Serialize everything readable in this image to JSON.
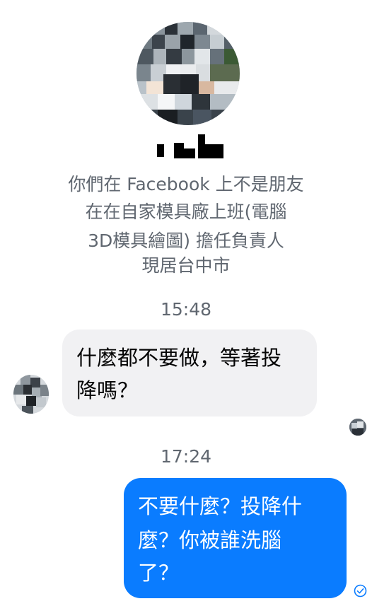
{
  "profile": {
    "info_lines": [
      "你們在 Facebook 上不是朋友",
      "在在自家模具廠上班(電腦",
      "3D模具繪圖) 擔任負責人",
      "現居台中市"
    ]
  },
  "messages": [
    {
      "timestamp": "15:48",
      "direction": "incoming",
      "lines": [
        "什麼都不要做，等著投",
        "降嗎？"
      ]
    },
    {
      "timestamp": "17:24",
      "direction": "outgoing",
      "lines": [
        "不要什麼？投降什",
        "麼？你被誰洗腦",
        "了？"
      ]
    }
  ],
  "colors": {
    "outgoing_bubble": "#0a7cff",
    "incoming_bubble": "#f1f1f3",
    "secondary_text": "#606770"
  },
  "icons": {
    "sent_status": "sent-check-icon"
  }
}
